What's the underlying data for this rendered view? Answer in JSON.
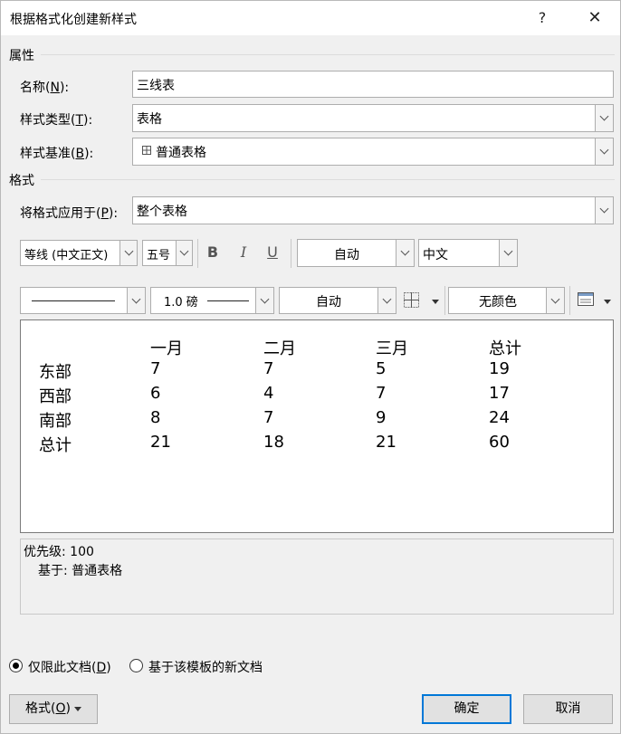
{
  "window": {
    "title": "根据格式化创建新样式",
    "help_label": "?",
    "close_label": "✕"
  },
  "properties": {
    "section_label": "属性",
    "name_label_pre": "名称(",
    "name_label_key": "N",
    "name_label_post": "):",
    "name_value": "三线表",
    "type_label_pre": "样式类型(",
    "type_label_key": "T",
    "type_label_post": "):",
    "type_value": "表格",
    "base_label_pre": "样式基准(",
    "base_label_key": "B",
    "base_label_post": "):",
    "base_value": "普通表格"
  },
  "format": {
    "section_label": "格式",
    "apply_label_pre": "将格式应用于(",
    "apply_label_key": "P",
    "apply_label_post": "):",
    "apply_value": "整个表格",
    "font_value": "等线 (中文正文)",
    "size_value": "五号",
    "bold_label": "B",
    "italic_label": "I",
    "underline_label": "U",
    "font_color_value": "自动",
    "script_value": "中文",
    "border_weight_value": "1.0 磅",
    "border_color_value": "自动",
    "shading_value": "无颜色"
  },
  "preview": {
    "headers": [
      "",
      "一月",
      "二月",
      "三月",
      "总计"
    ],
    "rows": [
      [
        "东部",
        "7",
        "7",
        "5",
        "19"
      ],
      [
        "西部",
        "6",
        "4",
        "7",
        "17"
      ],
      [
        "南部",
        "8",
        "7",
        "9",
        "24"
      ],
      [
        "总计",
        "21",
        "18",
        "21",
        "60"
      ]
    ]
  },
  "description": {
    "priority": "优先级: 100",
    "based_on": "基于: 普通表格"
  },
  "scope": {
    "this_doc_pre": "仅限此文档(",
    "this_doc_key": "D",
    "this_doc_post": ")",
    "this_doc_selected": true,
    "template_label": "基于该模板的新文档"
  },
  "buttons": {
    "format_pre": "格式(",
    "format_key": "O",
    "format_post": ")",
    "ok": "确定",
    "cancel": "取消"
  }
}
